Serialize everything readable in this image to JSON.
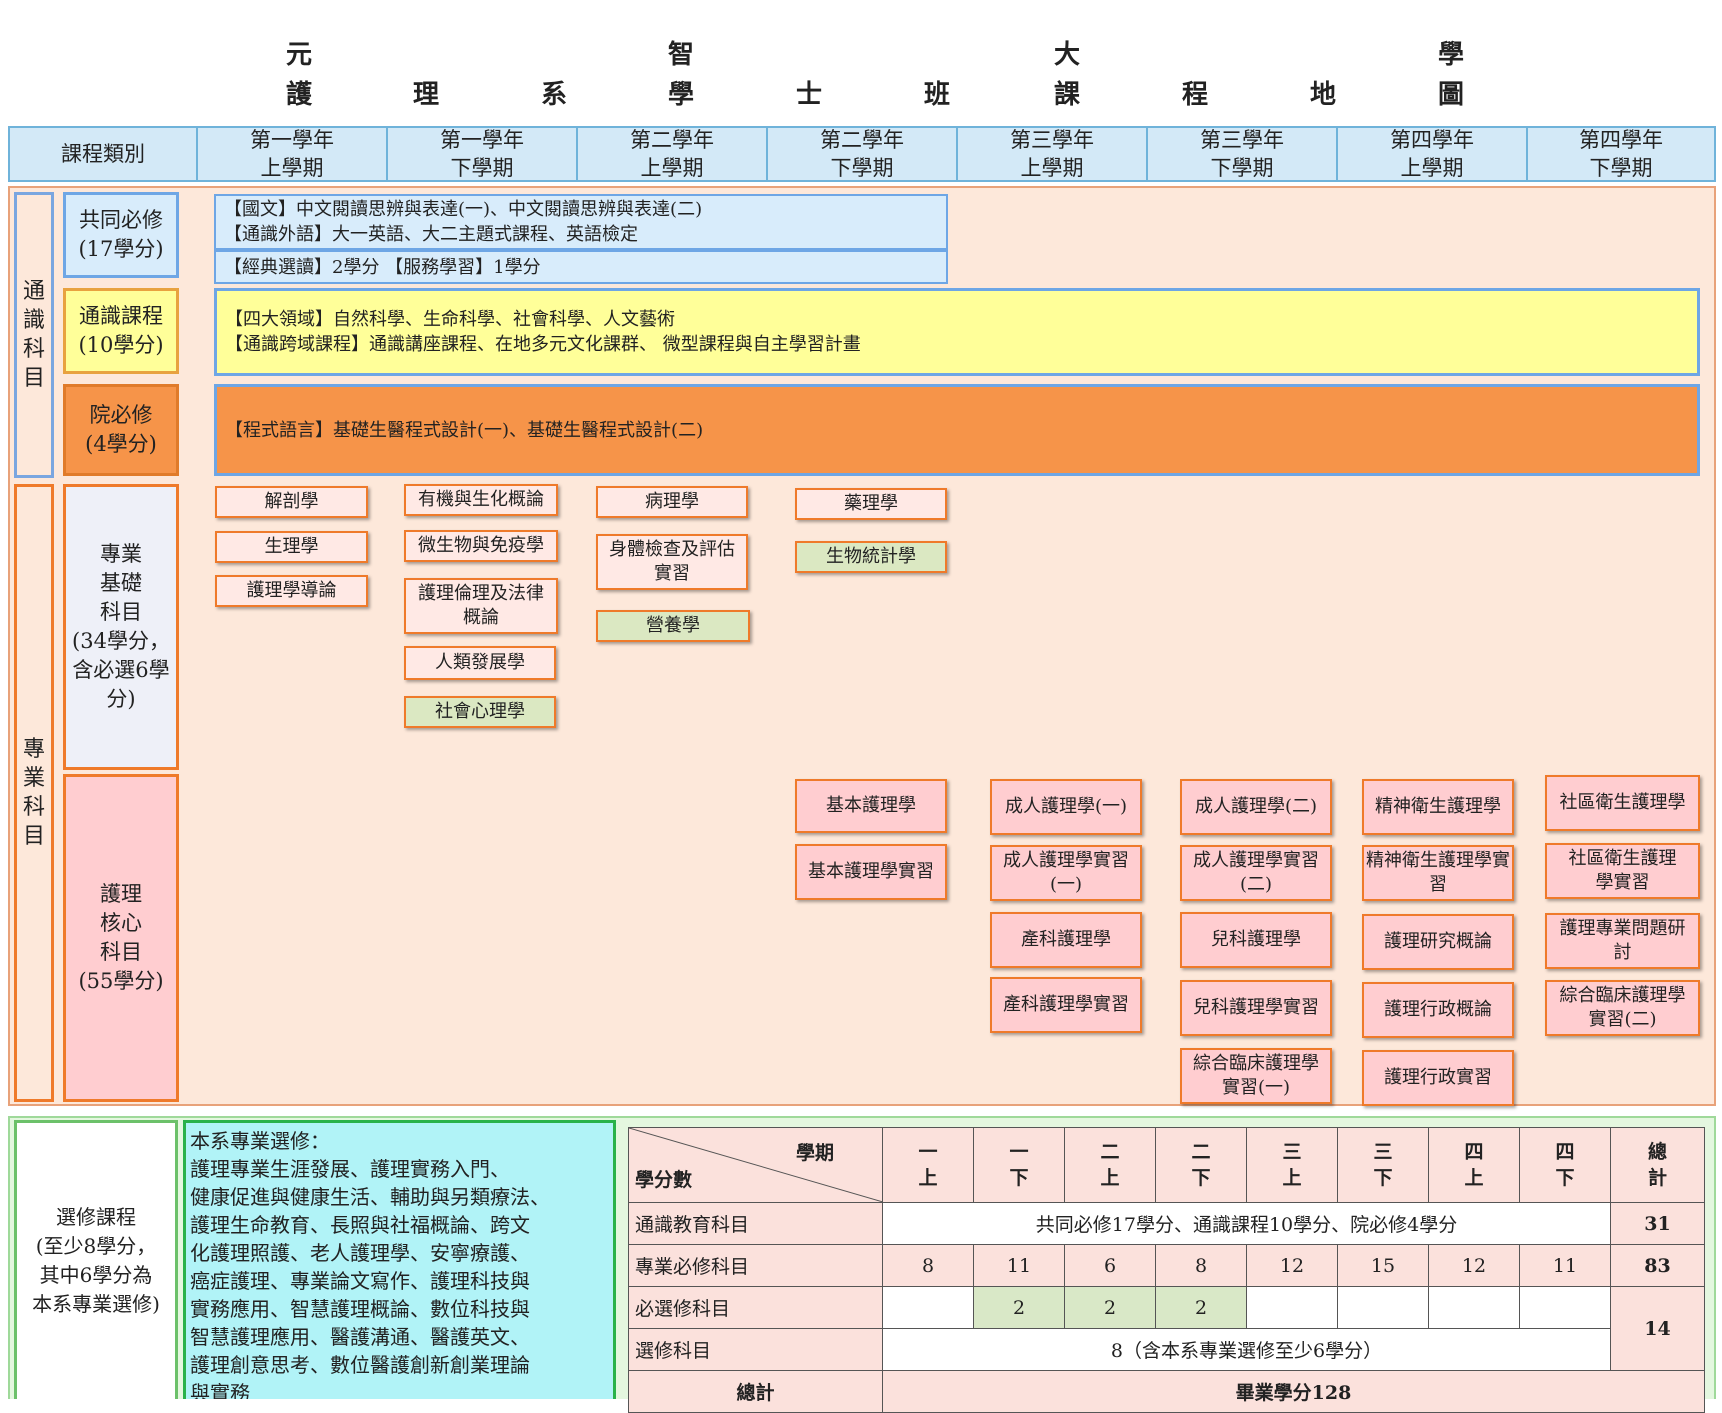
{
  "title": {
    "line1": [
      "元",
      "智",
      "大",
      "學"
    ],
    "line2": [
      "護",
      "理",
      "系",
      "學",
      "士",
      "班",
      "課",
      "程",
      "地",
      "圖"
    ]
  },
  "header": {
    "category_label": "課程類別",
    "semesters": [
      {
        "year": "第一學年",
        "term": "上學期"
      },
      {
        "year": "第一學年",
        "term": "下學期"
      },
      {
        "year": "第二學年",
        "term": "上學期"
      },
      {
        "year": "第二學年",
        "term": "下學期"
      },
      {
        "year": "第三學年",
        "term": "上學期"
      },
      {
        "year": "第三學年",
        "term": "下學期"
      },
      {
        "year": "第四學年",
        "term": "上學期"
      },
      {
        "year": "第四學年",
        "term": "下學期"
      }
    ]
  },
  "general": {
    "group_label": [
      "通",
      "識",
      "科",
      "目"
    ],
    "required": {
      "label": [
        "共同必修",
        "(17學分)"
      ],
      "line1": "【國文】中文閱讀思辨與表達(一)、中文閱讀思辨與表達(二)",
      "line2": "【通識外語】大一英語、大二主題式課程、英語檢定",
      "line3": "【經典選讀】2學分 【服務學習】1學分"
    },
    "courses": {
      "label": [
        "通識課程",
        "(10學分)"
      ],
      "line1": "【四大領域】自然科學、生命科學、社會科學、人文藝術",
      "line2": "【通識跨域課程】通識講座課程、在地多元文化課群、 微型課程與自主學習計畫"
    },
    "college": {
      "label": [
        "院必修",
        "(4學分)"
      ],
      "line1": "【程式語言】基礎生醫程式設計(一)、基礎生醫程式設計(二)"
    }
  },
  "professional": {
    "group_label": [
      "專",
      "業",
      "科",
      "目"
    ],
    "basic_label": [
      "專業",
      "基礎",
      "科目",
      "(34學分，",
      "含必選6學",
      "分)"
    ],
    "core_label": [
      "護理",
      "核心",
      "科目",
      "(55學分)"
    ],
    "basic_courses": {
      "y1s1": [
        "解剖學",
        "生理學",
        "護理學導論"
      ],
      "y1s2": [
        "有機與生化概論",
        "微生物與免疫學",
        "護理倫理及法律概論",
        "人類發展學",
        "社會心理學"
      ],
      "y2s1": [
        "病理學",
        "身體檢查及評估實習",
        "營養學"
      ],
      "y2s2": [
        "藥理學",
        "生物統計學"
      ]
    },
    "core_courses": {
      "y2s2": [
        "基本護理學",
        "基本護理學實習"
      ],
      "y3s1": [
        "成人護理學(一)",
        "成人護理學實習(一)",
        "產科護理學",
        "產科護理學實習"
      ],
      "y3s2": [
        "成人護理學(二)",
        "成人護理學實習(二)",
        "兒科護理學",
        "兒科護理學實習",
        "綜合臨床護理學實習(一)"
      ],
      "y4s1": [
        "精神衛生護理學",
        "精神衛生護理學實習",
        "護理研究概論",
        "護理行政概論",
        "護理行政實習"
      ],
      "y4s2": [
        "社區衛生護理學",
        "社區衛生護理學實習",
        "護理專業問題研討",
        "綜合臨床護理學實習(二)"
      ]
    }
  },
  "elective": {
    "label": [
      "選修課程",
      "(至少8學分，",
      "其中6學分為",
      "本系專業選修)"
    ],
    "lines": [
      "本系專業選修：",
      "護理專業生涯發展、護理實務入門、",
      "健康促進與健康生活、輔助與另類療法、",
      "護理生命教育、長照與社福概論、跨文",
      "化護理照護、老人護理學、安寧療護、",
      "癌症護理、專業論文寫作、護理科技與",
      "實務應用、智慧護理概論、數位科技與",
      "智慧護理應用、醫護溝通、醫護英文、",
      "護理創意思考、數位醫護創新創業理論",
      "與實務"
    ]
  },
  "credits_table": {
    "corner_top": "學期",
    "corner_bottom": "學分數",
    "semester_headers": [
      [
        "一",
        "上"
      ],
      [
        "一",
        "下"
      ],
      [
        "二",
        "上"
      ],
      [
        "二",
        "下"
      ],
      [
        "三",
        "上"
      ],
      [
        "三",
        "下"
      ],
      [
        "四",
        "上"
      ],
      [
        "四",
        "下"
      ]
    ],
    "total_header": [
      "總",
      "計"
    ],
    "rows": {
      "general": {
        "label": "通識教育科目",
        "merged": "共同必修17學分、通識課程10學分、院必修4學分",
        "total": "31"
      },
      "required": {
        "label": "專業必修科目",
        "values": [
          "8",
          "11",
          "6",
          "8",
          "12",
          "15",
          "12",
          "11"
        ],
        "total": "83"
      },
      "selective": {
        "label": "必選修科目",
        "values": [
          "",
          "2",
          "2",
          "2",
          "",
          "",
          "",
          ""
        ]
      },
      "elective": {
        "label": "選修科目",
        "merged": "8（含本系專業選修至少6學分）"
      },
      "shared_total": "14",
      "grand": {
        "label": "總計",
        "merged": "畢業學分128"
      }
    }
  },
  "colors": {
    "header_bg": "#d3e9f7",
    "section_bg": "#fde8da",
    "required_bg": "#d8ecfb",
    "general_bg": "#ffff99",
    "college_bg": "#f69449",
    "elective_bg": "#b1f3f7",
    "elective_section_bg": "#e4f7df"
  }
}
